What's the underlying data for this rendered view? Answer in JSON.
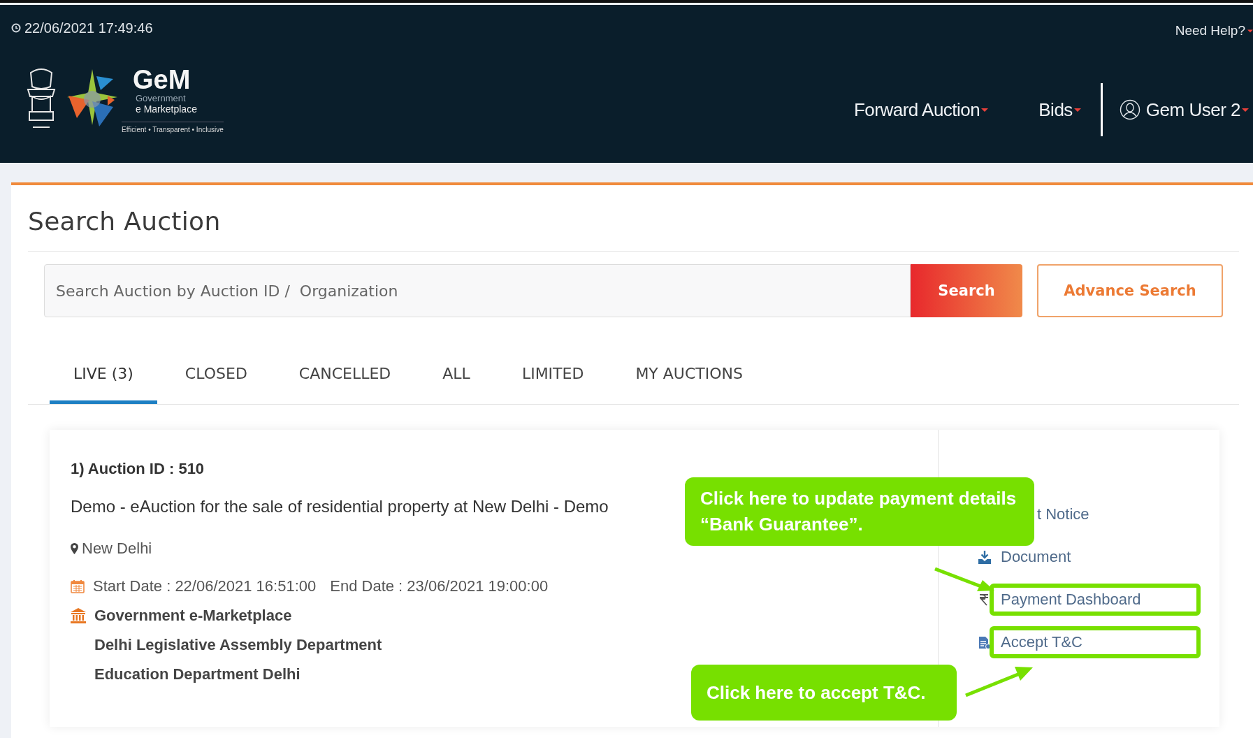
{
  "header": {
    "datetime": "22/06/2021 17:49:46",
    "need_help": "Need Help?",
    "logo": {
      "name": "GeM",
      "line1": "Government",
      "line2": "e Marketplace",
      "tagline": "Efficient • Transparent • Inclusive"
    },
    "nav": [
      {
        "label": "Forward Auction",
        "kind": "menu"
      },
      {
        "label": "Bids",
        "kind": "menu"
      },
      {
        "label": "Gem User 2",
        "kind": "user"
      }
    ]
  },
  "page": {
    "title": "Search Auction",
    "search": {
      "placeholder": "Search Auction by Auction ID /  Organization",
      "button": "Search",
      "advance_button": "Advance Search"
    },
    "tabs": [
      {
        "label": "LIVE (3)",
        "selected": true
      },
      {
        "label": "CLOSED",
        "selected": false
      },
      {
        "label": "CANCELLED",
        "selected": false
      },
      {
        "label": "ALL",
        "selected": false
      },
      {
        "label": "LIMITED",
        "selected": false
      },
      {
        "label": "MY AUCTIONS",
        "selected": false
      }
    ],
    "auction": {
      "heading": "1) Auction ID : 510",
      "description": "Demo - eAuction for the sale of residential property at New Delhi - Demo",
      "location": "New Delhi",
      "start": "Start Date : 22/06/2021 16:51:00",
      "end": "End Date : 23/06/2021 19:00:00",
      "organizations": [
        "Government e-Marketplace",
        "Delhi Legislative Assembly Department",
        "Education Department Delhi"
      ],
      "links": [
        {
          "text": "t Notice",
          "kind": "plain",
          "highlighted": false
        },
        {
          "text": "Document",
          "kind": "download",
          "highlighted": false
        },
        {
          "text": "Payment Dashboard",
          "kind": "rupee",
          "highlighted": true
        },
        {
          "text": "Accept T&C",
          "kind": "document",
          "highlighted": true
        }
      ]
    }
  },
  "annotations": [
    {
      "text": "Click here to update payment details “Bank Guarantee”.",
      "kind": "top"
    },
    {
      "text": "Click here to accept T&C.",
      "kind": "bottom"
    }
  ]
}
